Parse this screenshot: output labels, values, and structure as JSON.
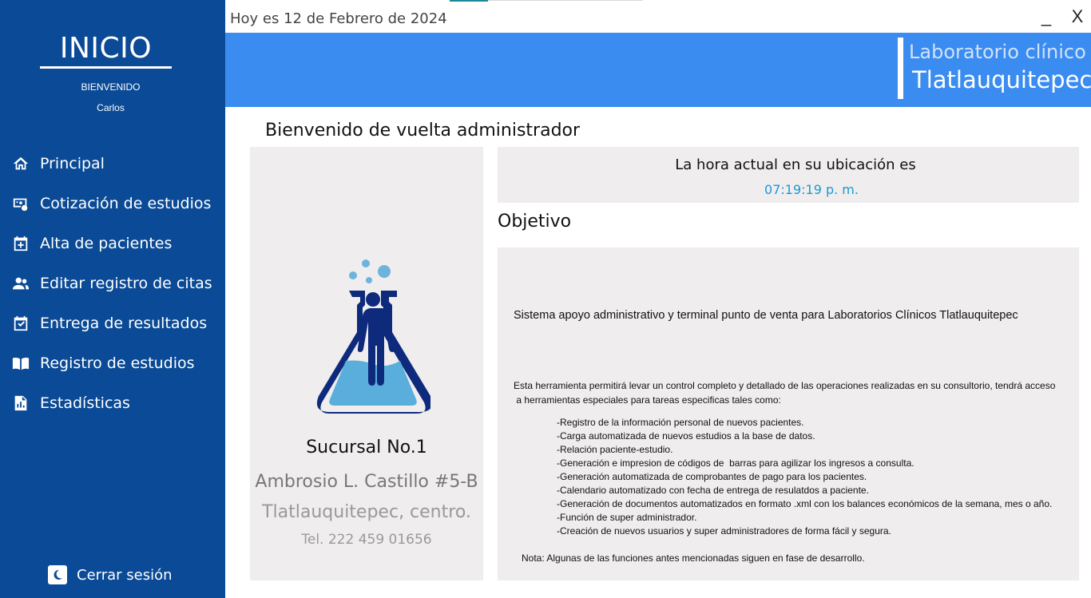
{
  "window": {
    "date_text": "Hoy es 12 de Febrero de 2024",
    "minimize_label": "_",
    "close_label": "X"
  },
  "sidebar": {
    "title": "INICIO",
    "welcome": "BIENVENIDO",
    "user": "Carlos",
    "items": [
      {
        "label": "Principal",
        "icon": "home-icon"
      },
      {
        "label": "Cotización de estudios",
        "icon": "money-card-icon"
      },
      {
        "label": "Alta de pacientes",
        "icon": "calendar-add-icon"
      },
      {
        "label": "Editar registro de citas",
        "icon": "people-icon"
      },
      {
        "label": "Entrega de resultados",
        "icon": "calendar-check-icon"
      },
      {
        "label": "Registro de estudios",
        "icon": "open-book-icon"
      },
      {
        "label": "Estadísticas",
        "icon": "report-chart-icon"
      }
    ],
    "logout_label": "Cerrar sesión",
    "colors": {
      "background": "#0a4a96",
      "text": "#ffffff"
    }
  },
  "header": {
    "lab_label": "Laboratorio clínico",
    "city": "Tlatlauquitepec",
    "color": "#3b8cf0"
  },
  "main": {
    "welcome_title": "Bienvenido de vuelta administrador",
    "branch": {
      "name": "Sucursal No.1",
      "address": "Ambrosio L. Castillo #5-B",
      "city": "Tlatlauquitepec, centro.",
      "phone": "Tel. 222 459 01656"
    },
    "time": {
      "label": "La hora actual en su ubicación es",
      "value": "07:19:19 p. m."
    },
    "objective": {
      "title": "Objetivo",
      "system_text": "Sistema apoyo administrativo y terminal punto de venta para Laboratorios Clínicos Tlatlauquitepec",
      "description_1": "Esta herramienta permitirá levar un control completo y detallado de las operaciones realizadas en su consultorio, tendrá acceso",
      "description_2": " a herramientas especiales para tareas especificas tales como:",
      "features": [
        "-Registro de la información personal de nuevos pacientes.",
        "-Carga automatizada de nuevos estudios a la base de datos.",
        "-Relación paciente-estudio.",
        "-Generación e impresion de códigos de  barras para agilizar los ingresos a consulta.",
        "-Generación automatizada de comprobantes de pago para los pacientes.",
        "-Calendario automatizado con fecha de entrega de resulatdos a paciente.",
        "-Generación de documentos automatizados en formato .xml con los balances económicos de la semana, mes o año.",
        "-Función de super administrador.",
        "-Creación de nuevos usuarios y super administradores de forma fácil y segura."
      ],
      "note": "Nota: Algunas de las funciones antes mencionadas siguen en fase de desarrollo."
    }
  }
}
